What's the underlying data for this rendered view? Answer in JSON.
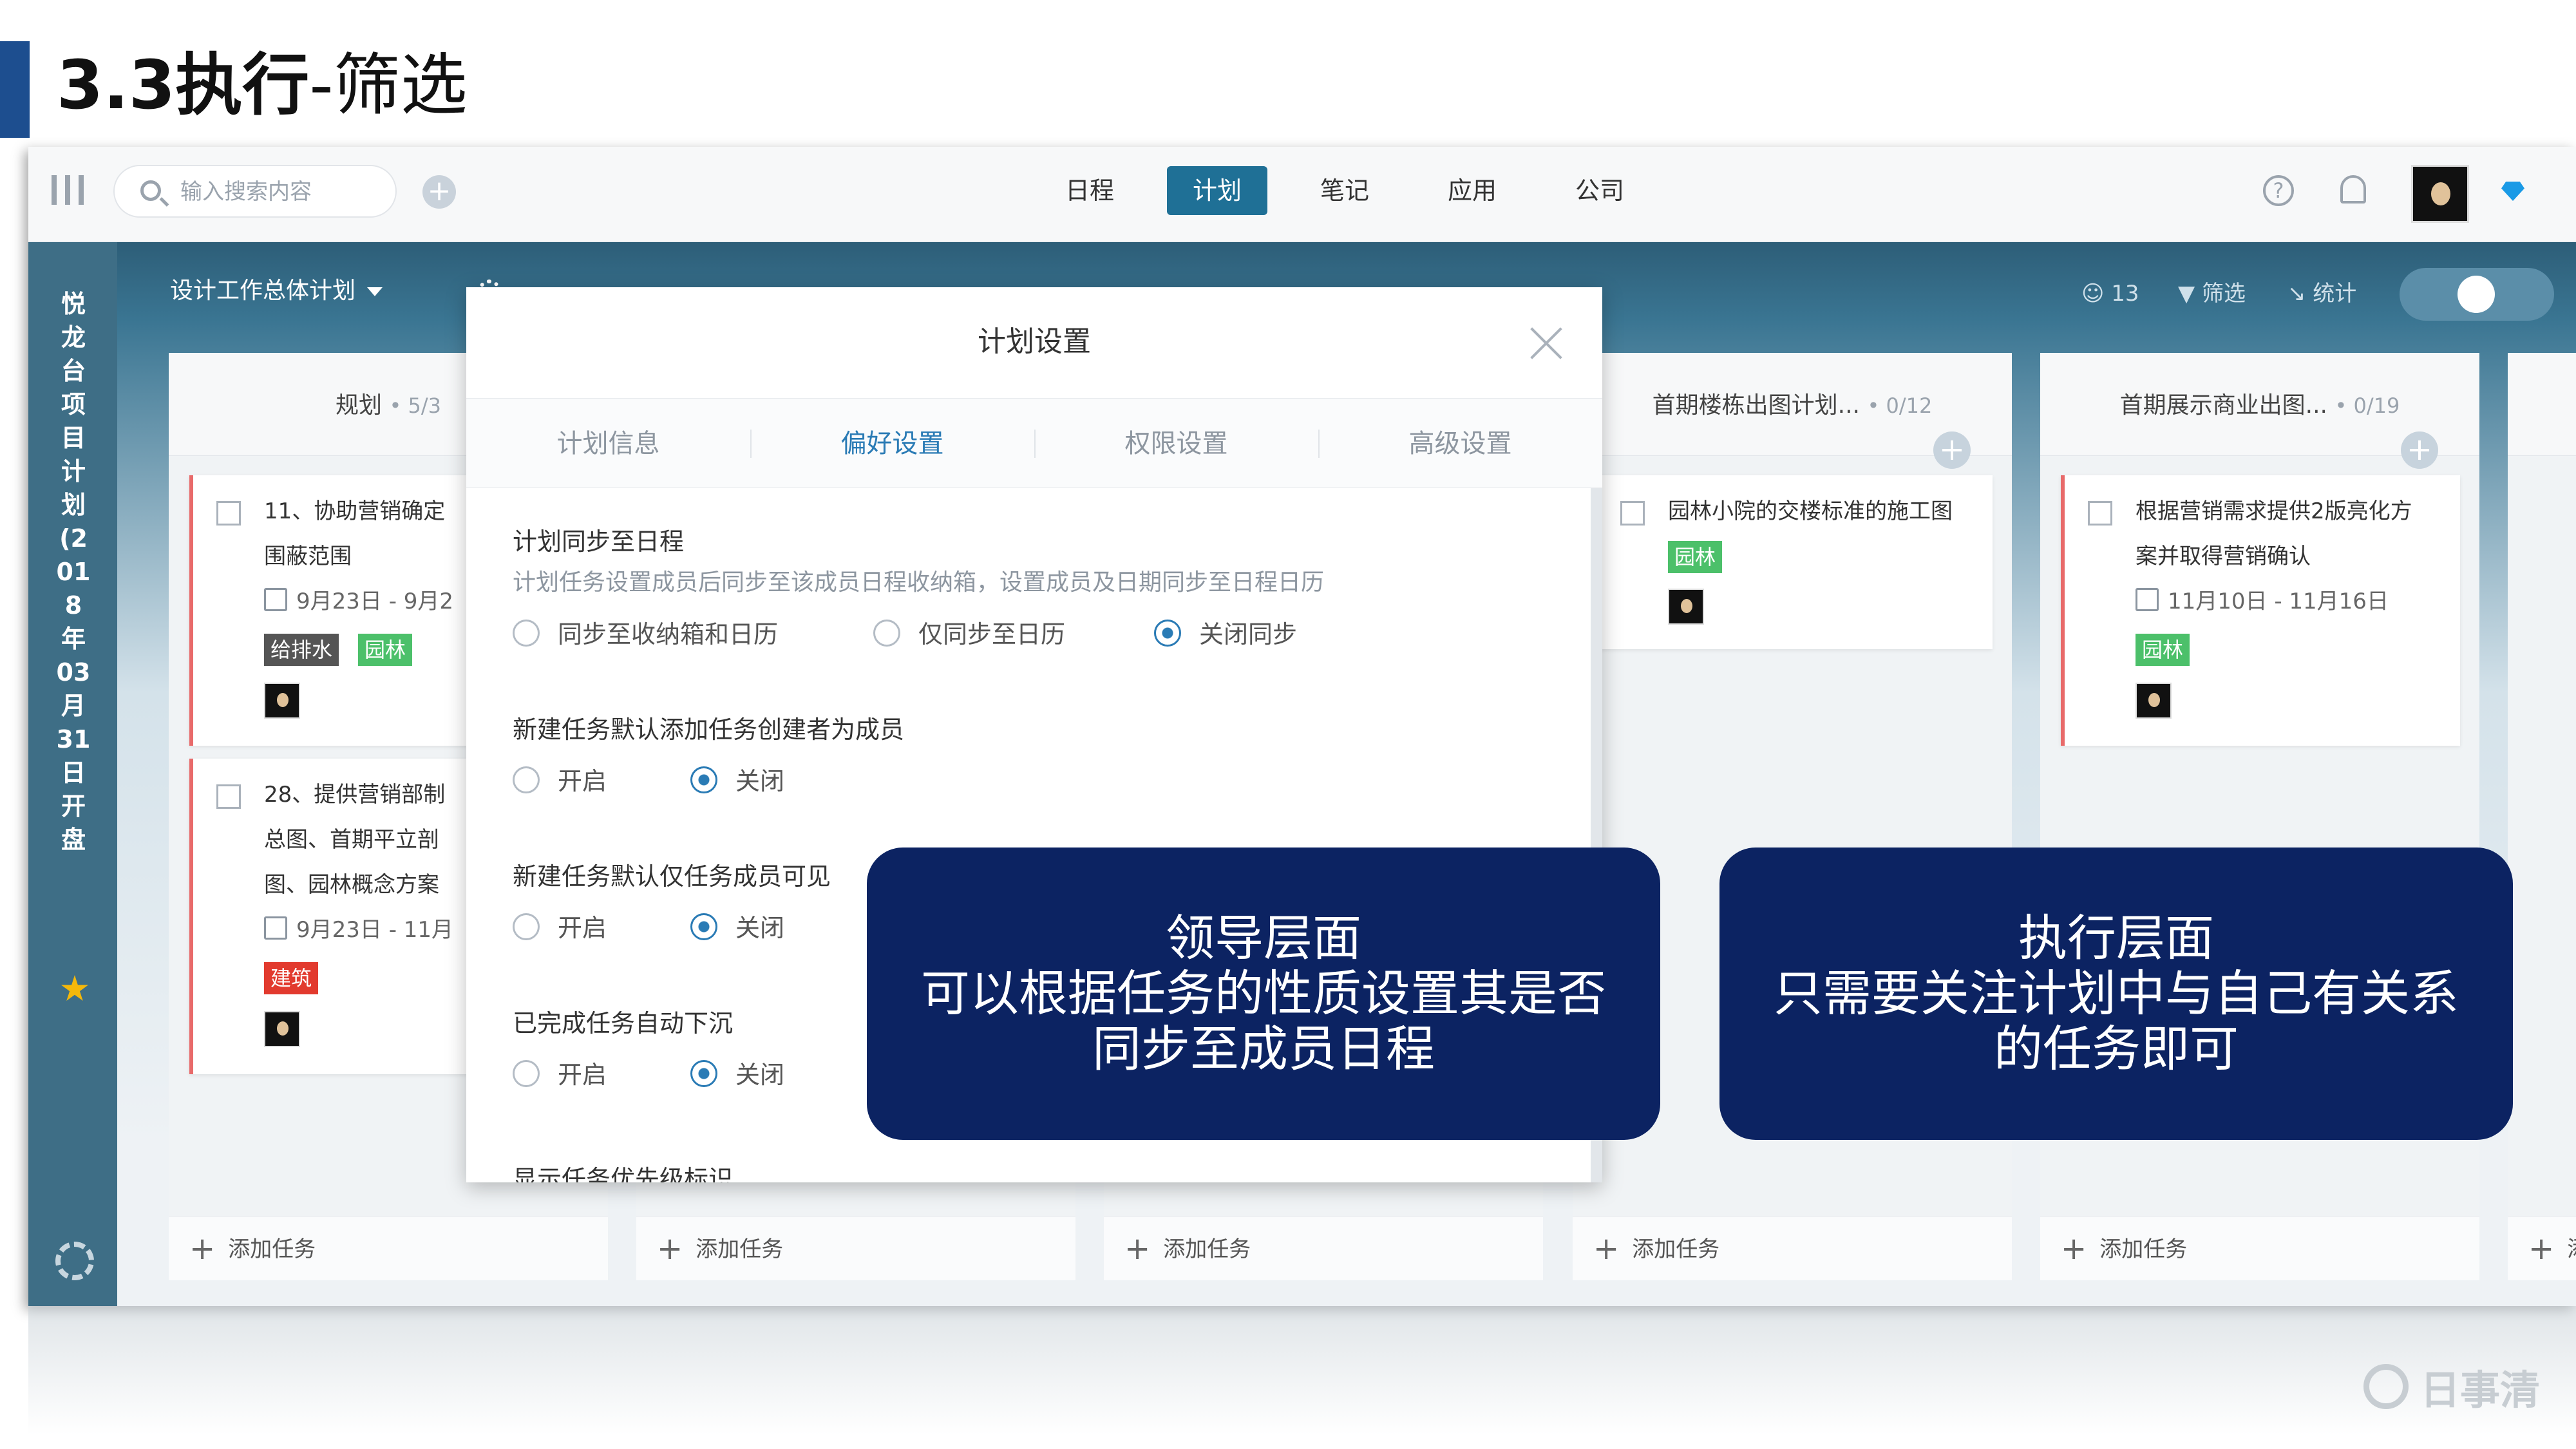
{
  "slide": {
    "title_num": "3.3执行",
    "title_rest": "-筛选",
    "accent_color": "#1d4e8f"
  },
  "topnav": {
    "search_placeholder": "输入搜索内容",
    "add_label": "+",
    "tabs": [
      {
        "label": "日程",
        "active": false
      },
      {
        "label": "计划",
        "active": true
      },
      {
        "label": "笔记",
        "active": false
      },
      {
        "label": "应用",
        "active": false
      },
      {
        "label": "公司",
        "active": false
      }
    ],
    "help_label": "?",
    "icons": [
      "menu-icon",
      "search-icon",
      "help-icon",
      "bell-icon",
      "avatar",
      "diamond-icon"
    ]
  },
  "sidebar": {
    "plan_title": "悦龙台项目计划(2018年03月31日开盘"
  },
  "toolbar": {
    "plan_name": "设计工作总体计划",
    "members": "13",
    "filter_label": "筛选",
    "stats_label": "统计"
  },
  "columns": [
    {
      "name": "规划",
      "count": "• 5/3",
      "add_task": "添加任务",
      "cards": [
        {
          "lines": [
            "11、协助营销确定",
            "围蔽范围"
          ],
          "date": "9月23日 - 9月2",
          "tags": [
            {
              "label": "给排水",
              "style": "dark"
            },
            {
              "label": "园林",
              "style": "green"
            }
          ]
        },
        {
          "lines": [
            "28、提供营销部制",
            "总图、首期平立剖",
            "图、园林概念方案"
          ],
          "date": "9月23日 - 11月",
          "tags": [
            {
              "label": "建筑",
              "style": "red"
            }
          ]
        }
      ]
    },
    {
      "add_task": "添加任务"
    },
    {
      "add_task": "添加任务"
    },
    {
      "name": "首期楼栋出图计划...",
      "count": "• 0/12",
      "add_task": "添加任务",
      "cards": [
        {
          "lines": [
            "园林小院的交楼标准的施工图"
          ],
          "date": "",
          "tags": [
            {
              "label": "园林",
              "style": "green"
            }
          ]
        }
      ]
    },
    {
      "name": "首期展示商业出图...",
      "count": "• 0/19",
      "add_task": "添加任务",
      "cards": [
        {
          "lines": [
            "根据营销需求提供2版亮化方",
            "案并取得营销确认"
          ],
          "date": "11月10日 - 11月16日",
          "tags": [
            {
              "label": "园林",
              "style": "green"
            }
          ]
        }
      ]
    },
    {
      "add_task": "添"
    }
  ],
  "modal": {
    "title": "计划设置",
    "tabs": [
      {
        "label": "计划信息",
        "active": false
      },
      {
        "label": "偏好设置",
        "active": true
      },
      {
        "label": "权限设置",
        "active": false
      },
      {
        "label": "高级设置",
        "active": false
      }
    ],
    "sections": [
      {
        "title": "计划同步至日程",
        "desc": "计划任务设置成员后同步至该成员日程收纳箱，设置成员及日期同步至日程日历",
        "options": [
          {
            "label": "同步至收纳箱和日历",
            "checked": false
          },
          {
            "label": "仅同步至日历",
            "checked": false
          },
          {
            "label": "关闭同步",
            "checked": true
          }
        ]
      },
      {
        "title": "新建任务默认添加任务创建者为成员",
        "options": [
          {
            "label": "开启",
            "checked": false
          },
          {
            "label": "关闭",
            "checked": true
          }
        ]
      },
      {
        "title": "新建任务默认仅任务成员可见",
        "options": [
          {
            "label": "开启",
            "checked": false
          },
          {
            "label": "关闭",
            "checked": true
          }
        ]
      },
      {
        "title": "已完成任务自动下沉",
        "options": [
          {
            "label": "开启",
            "checked": false
          },
          {
            "label": "关闭",
            "checked": true
          }
        ]
      },
      {
        "title": "显示任务优先级标识"
      }
    ]
  },
  "callouts": [
    {
      "lines": [
        "领导层面",
        "可以根据任务的性质设置其是否",
        "同步至成员日程"
      ]
    },
    {
      "lines": [
        "执行层面",
        "只需要关注计划中与自己有关系",
        "的任务即可"
      ]
    }
  ],
  "logo": {
    "text": "日事清"
  },
  "colors": {
    "callout_bg": "#0c2362",
    "active_tab": "#1f7096",
    "sidebar": "#3e6e86",
    "tag_green": "#4cc06a",
    "tag_red": "#e23a2e"
  }
}
